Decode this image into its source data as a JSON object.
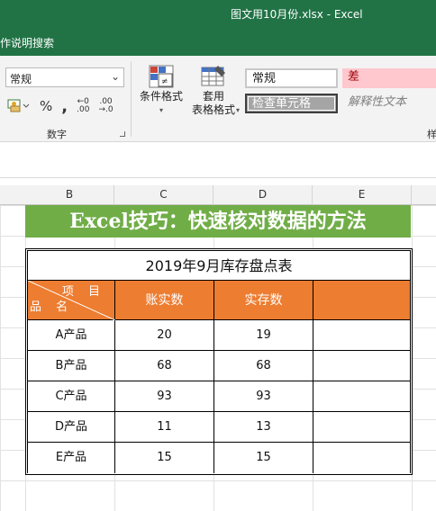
{
  "window": {
    "title": "图文用10月份.xlsx  -  Excel"
  },
  "menu": {
    "search_label": "作说明搜索"
  },
  "ribbon": {
    "number_format": {
      "value": "常规"
    },
    "number_group_label": "数字",
    "conditional_format": {
      "label": "条件格式"
    },
    "table_format": {
      "line1": "套用",
      "line2": "表格格式"
    },
    "styles": {
      "normal": "常规",
      "bad": "差",
      "check_cell": "检查单元格",
      "explanatory": "解释性文本"
    },
    "styles_group_label": "样"
  },
  "columns": [
    "B",
    "C",
    "D",
    "E"
  ],
  "sheet": {
    "banner": "Excel技巧：快速核对数据的方法",
    "table_title": "2019年9月库存盘点表",
    "header_diag_top": "项 目",
    "header_diag_bottom": "品 名",
    "headers": [
      "账实数",
      "实存数",
      ""
    ],
    "rows": [
      {
        "name": "A产品",
        "book": "20",
        "actual": "19"
      },
      {
        "name": "B产品",
        "book": "68",
        "actual": "68"
      },
      {
        "name": "C产品",
        "book": "93",
        "actual": "93"
      },
      {
        "name": "D产品",
        "book": "11",
        "actual": "13"
      },
      {
        "name": "E产品",
        "book": "15",
        "actual": "15"
      }
    ]
  },
  "colors": {
    "excel_green": "#217346",
    "banner_green": "#70ad47",
    "header_orange": "#ed7d31",
    "bad_fill": "#ffc7ce",
    "bad_text": "#9c0006"
  }
}
